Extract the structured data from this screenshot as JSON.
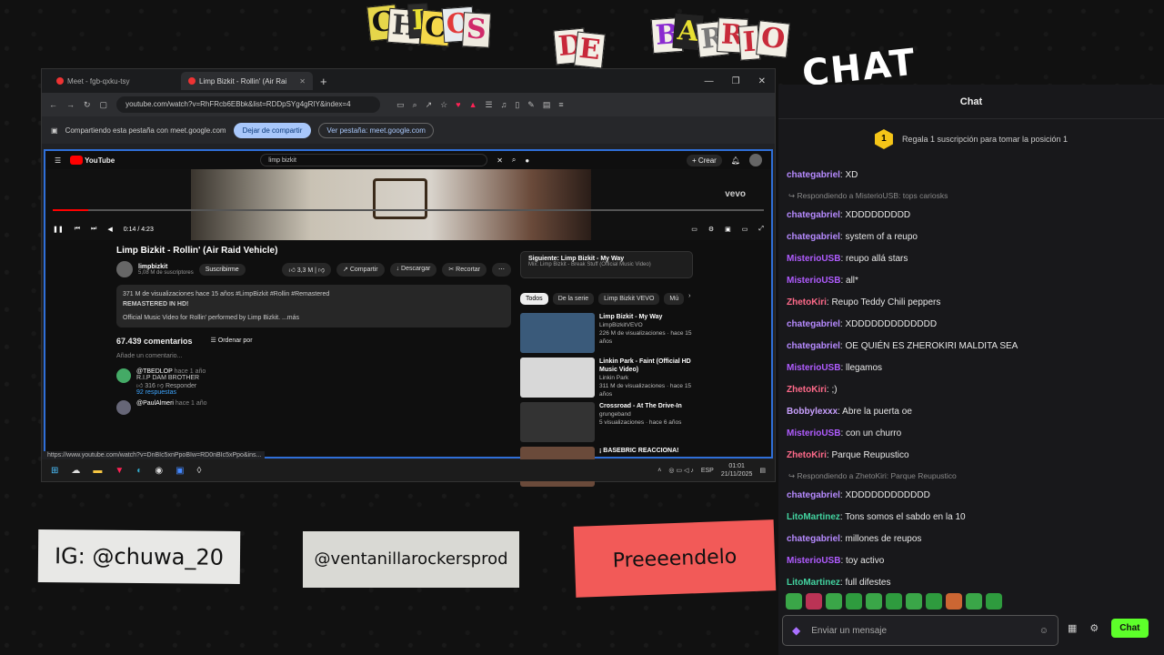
{
  "title": {
    "letters": [
      {
        "t": "C",
        "bg": "#e6d64a",
        "fg": "#111"
      },
      {
        "t": "H",
        "bg": "#f3eee0",
        "fg": "#333"
      },
      {
        "t": "I",
        "bg": "#2c2c2c",
        "fg": "#e8e032"
      },
      {
        "t": "C",
        "bg": "#f5d84a",
        "fg": "#111"
      },
      {
        "t": "O",
        "bg": "#e6ecf0",
        "fg": "#e23a3a"
      },
      {
        "t": "S",
        "bg": "#eeeae0",
        "fg": "#d02a6a"
      },
      {
        "t": "D",
        "bg": "#f2efe6",
        "fg": "#c8283a"
      },
      {
        "t": "E",
        "bg": "#f2efe6",
        "fg": "#c8283a"
      },
      {
        "t": "B",
        "bg": "#f2efe6",
        "fg": "#8a2ad0"
      },
      {
        "t": "A",
        "bg": "#222",
        "fg": "#e8e032"
      },
      {
        "t": "R",
        "bg": "#f2efe6",
        "fg": "#7a7a7a"
      },
      {
        "t": "R",
        "bg": "#f2efe6",
        "fg": "#c82a3a"
      },
      {
        "t": "I",
        "bg": "#f2efe6",
        "fg": "#c82a3a"
      },
      {
        "t": "O",
        "bg": "#f2efe6",
        "fg": "#c82a3a"
      }
    ],
    "chat_heading": "CHAT"
  },
  "browser": {
    "tabs": [
      {
        "label": "Meet - fgb-qxku-tsy",
        "active": false
      },
      {
        "label": "Limp Bizkit - Rollin' (Air Rai",
        "active": true
      }
    ],
    "url": "youtube.com/watch?v=RhFRcb6EBbk&list=RDDpSYg4gRIY&index=4",
    "share_text": "Compartiendo esta pestaña con meet.google.com",
    "stop_share_label": "Dejar de compartir",
    "view_tab_label": "Ver pestaña: meet.google.com"
  },
  "youtube": {
    "logo": "YouTube",
    "search": "limp bizkit",
    "create_label": "+ Crear",
    "vevo": "vevo",
    "time": "0:14 / 4:23",
    "progress": 0.05,
    "video_title": "Limp Bizkit - Rollin' (Air Raid Vehicle)",
    "channel": "limpbizkit",
    "subscribers": "5,08 M de suscriptores",
    "subscribe_label": "Suscribirme",
    "likes": "3,3 M",
    "share_label": "Compartir",
    "download_label": "Descargar",
    "clip_label": "Recortar",
    "desc_line1": "371 M de visualizaciones  hace 15 años  #LimpBizkit #Rollin #Remastered",
    "desc_line2": "REMASTERED IN HD!",
    "desc_line3": "Official Music Video for Rollin' performed by Limp Bizkit.  ...más",
    "comments_count": "67.439 comentarios",
    "sort_label": "Ordenar por",
    "add_comment": "Añade un comentario...",
    "comment1_user": "@TBEDLOP",
    "comment1_time": "hace 1 año",
    "comment1_text": "R.I.P DAM BROTHER",
    "comment1_likes": "316",
    "comment1_reply": "Responder",
    "comment1_replies": "92 respuestas",
    "comment2_user": "@PaulAlmeri",
    "comment2_time": "hace 1 año",
    "upnext_title": "Siguiente: Limp Bizkit - My Way",
    "upnext_sub": "Mix: Limp Bizkit - Break Stuff (Official Music Video)",
    "chips": [
      "Todos",
      "De la serie",
      "Limp Bizkit VEVO",
      "Mú"
    ],
    "recs": [
      {
        "title": "Limp Bizkit - My Way",
        "sub": "LimpBizkitVEVO",
        "views": "226 M de visualizaciones · hace 15 años",
        "color": "#3a5a7a"
      },
      {
        "title": "Linkin Park - Faint (Official HD Music Video)",
        "sub": "Linkin Park",
        "views": "311 M de visualizaciones · hace 15 años",
        "color": "#d8d8d8"
      },
      {
        "title": "Crossroad - At The Drive-In",
        "sub": "grungeband",
        "views": "5 visualizaciones · hace 6 años",
        "color": "#333"
      },
      {
        "title": "¡ BASEBRIC REACCIONA!",
        "sub": "",
        "views": "",
        "color": "#6a4a3a"
      }
    ],
    "status_url": "https://www.youtube.com/watch?v=DnBIc5xnPpoBIw=RD0nBIc5xPpo&ins..."
  },
  "taskbar": {
    "time": "01:01",
    "date": "21/11/2025",
    "lang": "ESP"
  },
  "labels": {
    "ig": "IG: @chuwa_20",
    "producer": "@ventanillarockersprod",
    "tagline": "Preeeendelo"
  },
  "chat": {
    "title": "Chat",
    "gift_num": "1",
    "gift_text": "Regala 1 suscripción para tomar la posición 1",
    "placeholder": "Enviar un mensaje",
    "send_label": "Chat",
    "messages": [
      {
        "user": "chategabriel",
        "text": "XD",
        "color": "#b68aff"
      },
      {
        "reply": "Respondiendo a MisterioUSB: tops cariosks"
      },
      {
        "user": "chategabriel",
        "text": "XDDDDDDDDD",
        "color": "#b68aff"
      },
      {
        "user": "chategabriel",
        "text": "system of a reupo",
        "color": "#b68aff"
      },
      {
        "user": "MisterioUSB",
        "text": "reupo allá stars",
        "color": "#b05cff"
      },
      {
        "user": "MisterioUSB",
        "text": "all*",
        "color": "#b05cff"
      },
      {
        "user": "ZhetoKiri",
        "text": "Reupo Teddy Chili peppers",
        "color": "#ff6a8a"
      },
      {
        "user": "chategabriel",
        "text": "XDDDDDDDDDDDDD",
        "color": "#b68aff"
      },
      {
        "user": "chategabriel",
        "text": "OE QUIÉN ES ZHEROKIRI MALDITA SEA",
        "color": "#b68aff"
      },
      {
        "user": "MisterioUSB",
        "text": "llegamos",
        "color": "#b05cff"
      },
      {
        "user": "ZhetoKiri",
        "text": ";)",
        "color": "#ff6a8a"
      },
      {
        "user": "Bobbylexxx",
        "text": "Abre la puerta oe",
        "color": "#c9a0ff"
      },
      {
        "user": "MisterioUSB",
        "text": "con un churro",
        "color": "#b05cff"
      },
      {
        "user": "ZhetoKiri",
        "text": "Parque Reupustico",
        "color": "#ff6a8a"
      },
      {
        "reply": "Respondiendo a ZhetoKiri: Parque Reupustico"
      },
      {
        "user": "chategabriel",
        "text": "XDDDDDDDDDDDD",
        "color": "#b68aff"
      },
      {
        "user": "LitoMartinez",
        "text": "Tons somos el sabdo en la 10",
        "color": "#43d3a0"
      },
      {
        "user": "chategabriel",
        "text": "millones de reupos",
        "color": "#b68aff"
      },
      {
        "user": "MisterioUSB",
        "text": "toy activo",
        "color": "#b05cff"
      },
      {
        "user": "LitoMartinez",
        "text": "full difestes",
        "color": "#43d3a0"
      }
    ]
  }
}
